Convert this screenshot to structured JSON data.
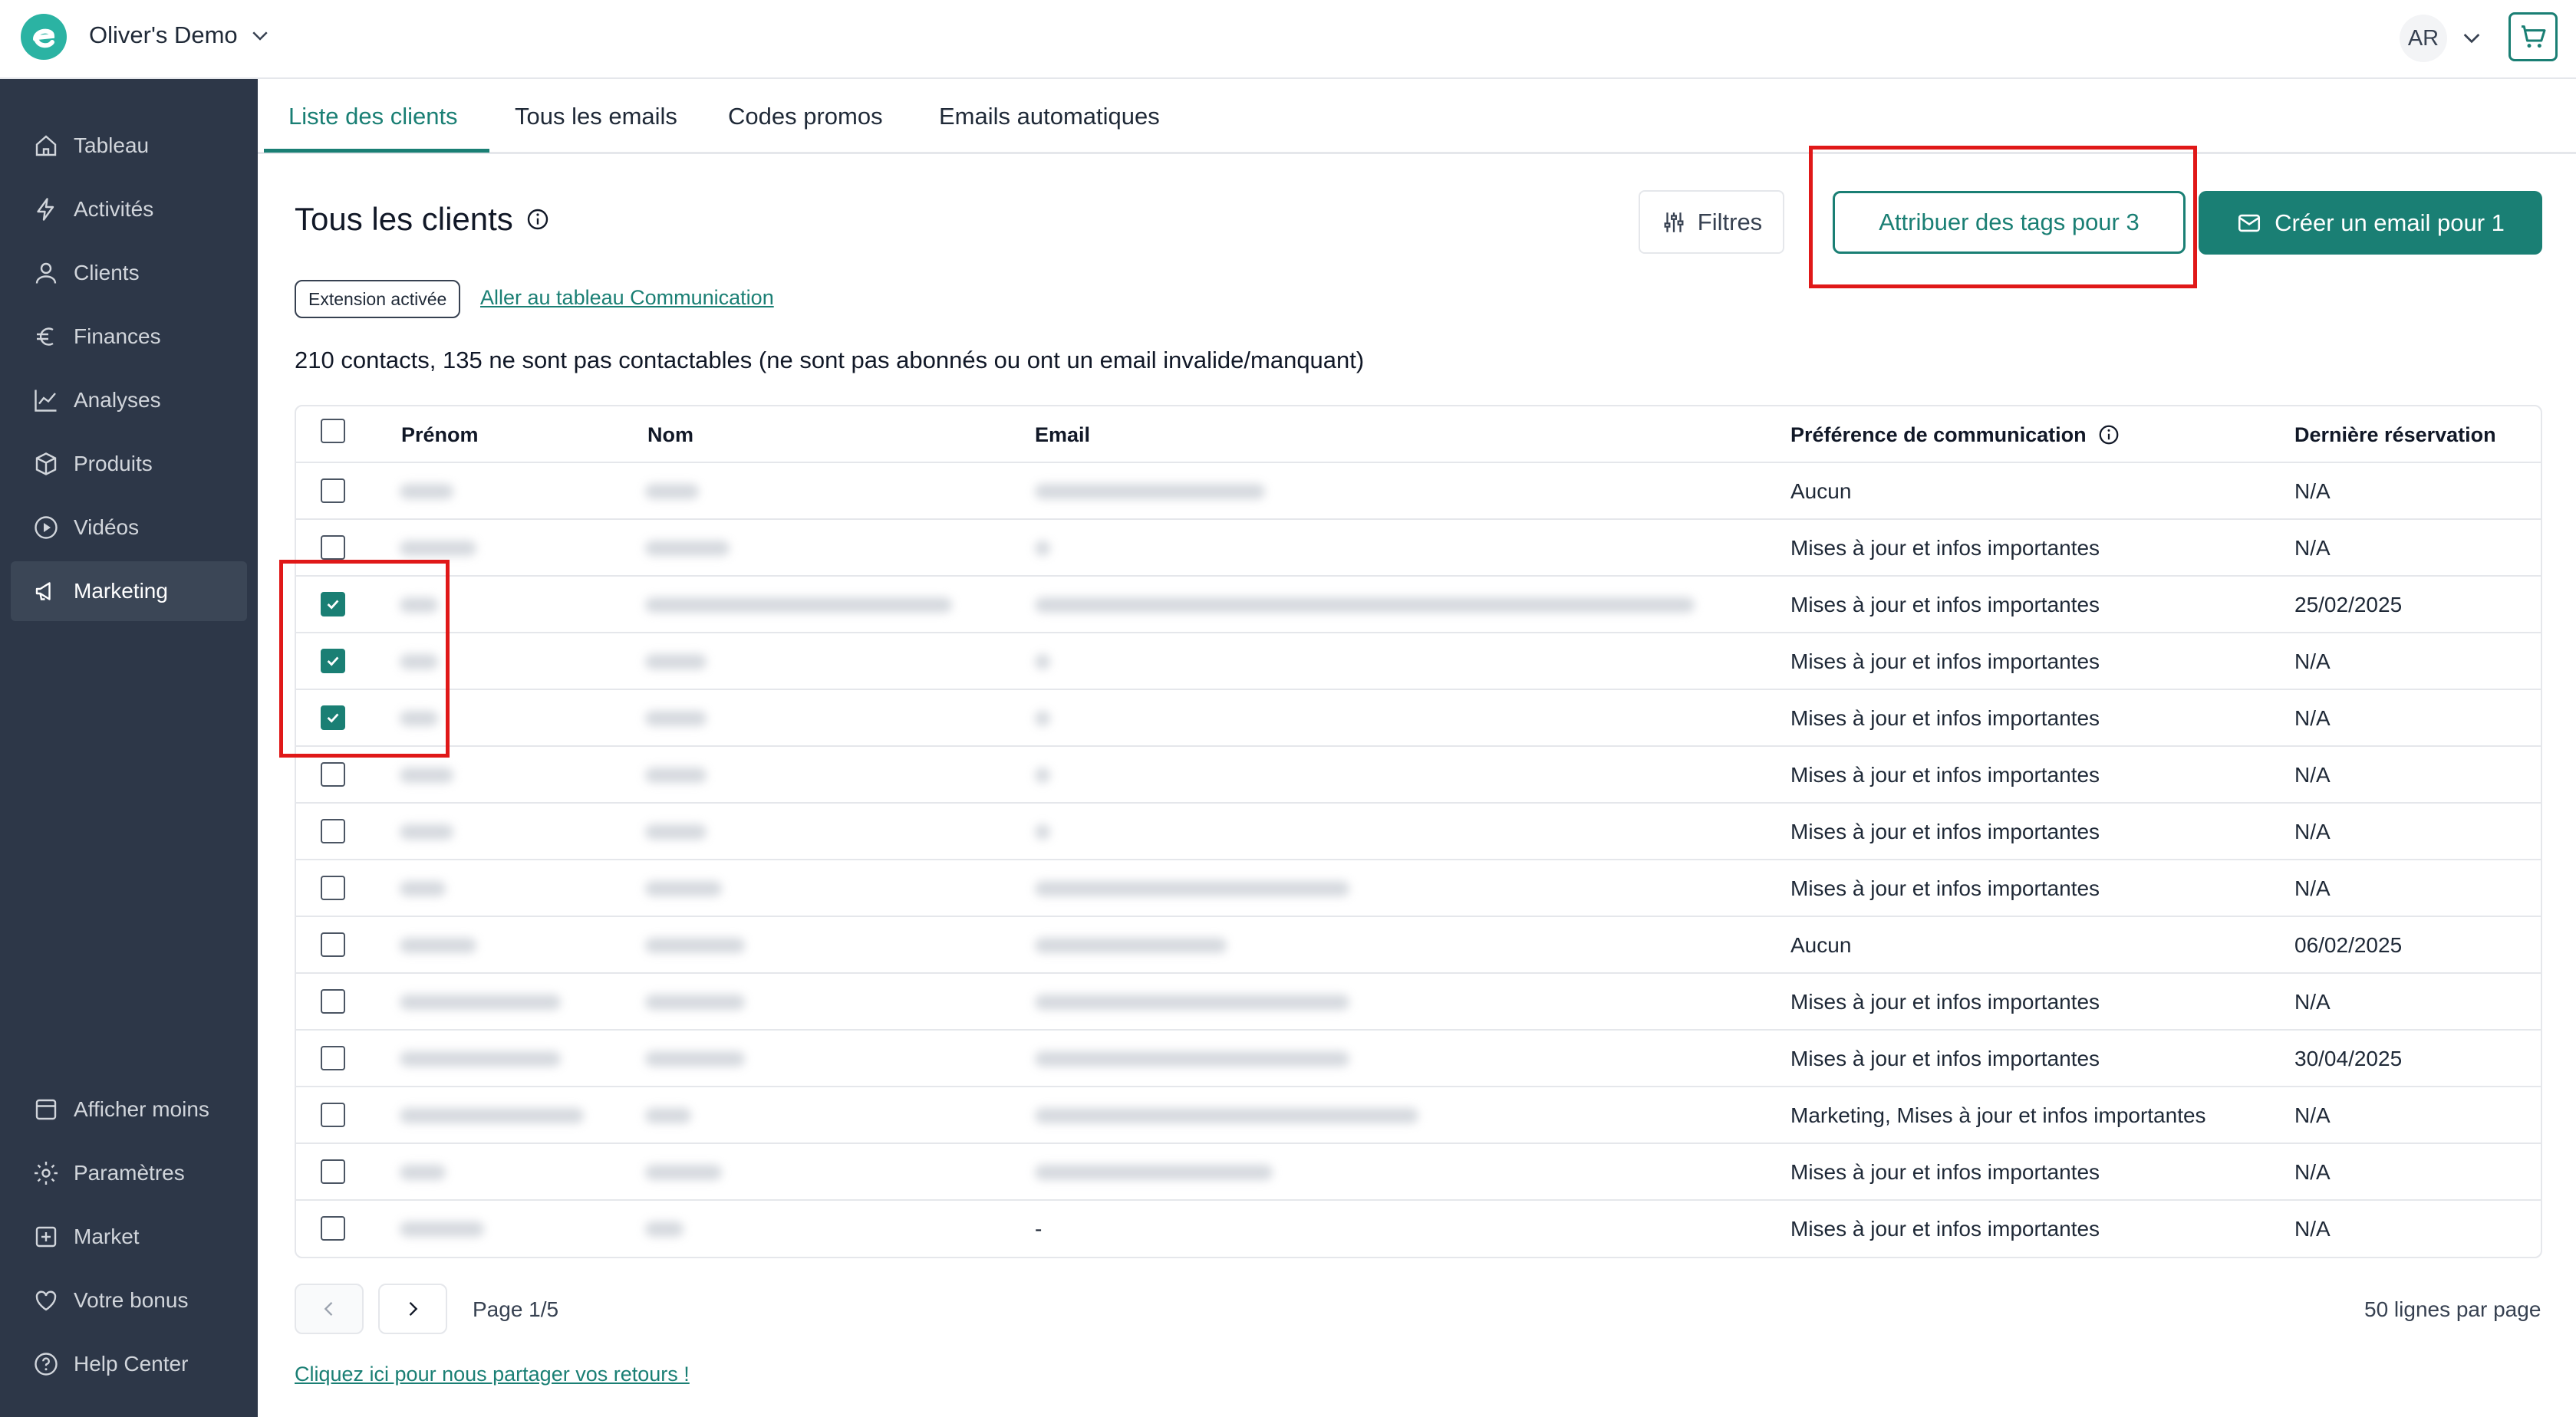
{
  "header": {
    "org_name": "Oliver's Demo",
    "avatar_initials": "AR"
  },
  "sidebar": {
    "items": [
      {
        "label": "Tableau",
        "icon": "home-icon"
      },
      {
        "label": "Activités",
        "icon": "bolt-icon"
      },
      {
        "label": "Clients",
        "icon": "user-icon"
      },
      {
        "label": "Finances",
        "icon": "euro-icon"
      },
      {
        "label": "Analyses",
        "icon": "chart-line-icon"
      },
      {
        "label": "Produits",
        "icon": "box-icon"
      },
      {
        "label": "Vidéos",
        "icon": "play-icon"
      },
      {
        "label": "Marketing",
        "icon": "megaphone-icon",
        "active": true
      }
    ],
    "bottom_items": [
      {
        "label": "Afficher moins",
        "icon": "panel-icon"
      },
      {
        "label": "Paramètres",
        "icon": "gear-icon"
      },
      {
        "label": "Market",
        "icon": "plus-square-icon"
      },
      {
        "label": "Votre bonus",
        "icon": "heart-icon"
      },
      {
        "label": "Help Center",
        "icon": "help-icon"
      }
    ]
  },
  "tabs": [
    {
      "label": "Liste des clients",
      "active": true
    },
    {
      "label": "Tous les emails"
    },
    {
      "label": "Codes promos"
    },
    {
      "label": "Emails automatiques"
    }
  ],
  "main": {
    "title": "Tous les clients",
    "filters_label": "Filtres",
    "assign_tags_label": "Attribuer des tags pour 3",
    "create_email_label": "Créer un email pour 1",
    "extension_badge": "Extension activée",
    "communication_link": "Aller au tableau Communication",
    "summary": "210 contacts, 135 ne sont pas contactables (ne sont pas abonnés ou ont un email invalide/manquant)"
  },
  "table": {
    "columns": [
      "Prénom",
      "Nom",
      "Email",
      "Préférence de communication",
      "Dernière réservation"
    ],
    "rows": [
      {
        "checked": false,
        "email": "",
        "preference": "Aucun",
        "last_booking": "N/A"
      },
      {
        "checked": false,
        "email": "",
        "preference": "Mises à jour et infos importantes",
        "last_booking": "N/A"
      },
      {
        "checked": true,
        "email": "",
        "preference": "Mises à jour et infos importantes",
        "last_booking": "25/02/2025"
      },
      {
        "checked": true,
        "email": "",
        "preference": "Mises à jour et infos importantes",
        "last_booking": "N/A"
      },
      {
        "checked": true,
        "email": "",
        "preference": "Mises à jour et infos importantes",
        "last_booking": "N/A"
      },
      {
        "checked": false,
        "email": "",
        "preference": "Mises à jour et infos importantes",
        "last_booking": "N/A"
      },
      {
        "checked": false,
        "email": "",
        "preference": "Mises à jour et infos importantes",
        "last_booking": "N/A"
      },
      {
        "checked": false,
        "email": "",
        "preference": "Mises à jour et infos importantes",
        "last_booking": "N/A"
      },
      {
        "checked": false,
        "email": "",
        "preference": "Aucun",
        "last_booking": "06/02/2025"
      },
      {
        "checked": false,
        "email": "",
        "preference": "Mises à jour et infos importantes",
        "last_booking": "N/A"
      },
      {
        "checked": false,
        "email": "",
        "preference": "Mises à jour et infos importantes",
        "last_booking": "30/04/2025"
      },
      {
        "checked": false,
        "email": "",
        "preference": "Marketing, Mises à jour et infos importantes",
        "last_booking": "N/A"
      },
      {
        "checked": false,
        "email": "",
        "preference": "Mises à jour et infos importantes",
        "last_booking": "N/A"
      },
      {
        "checked": false,
        "email": "-",
        "preference": "Mises à jour et infos importantes",
        "last_booking": "N/A"
      }
    ]
  },
  "pagination": {
    "page_label": "Page 1/5",
    "per_page_label": "50 lignes par page"
  },
  "footer": {
    "feedback_link": "Cliquez ici pour nous partager vos retours !"
  },
  "colors": {
    "accent": "#1a7f74",
    "sidebar_bg": "#2d3748",
    "highlight": "#e01818"
  }
}
